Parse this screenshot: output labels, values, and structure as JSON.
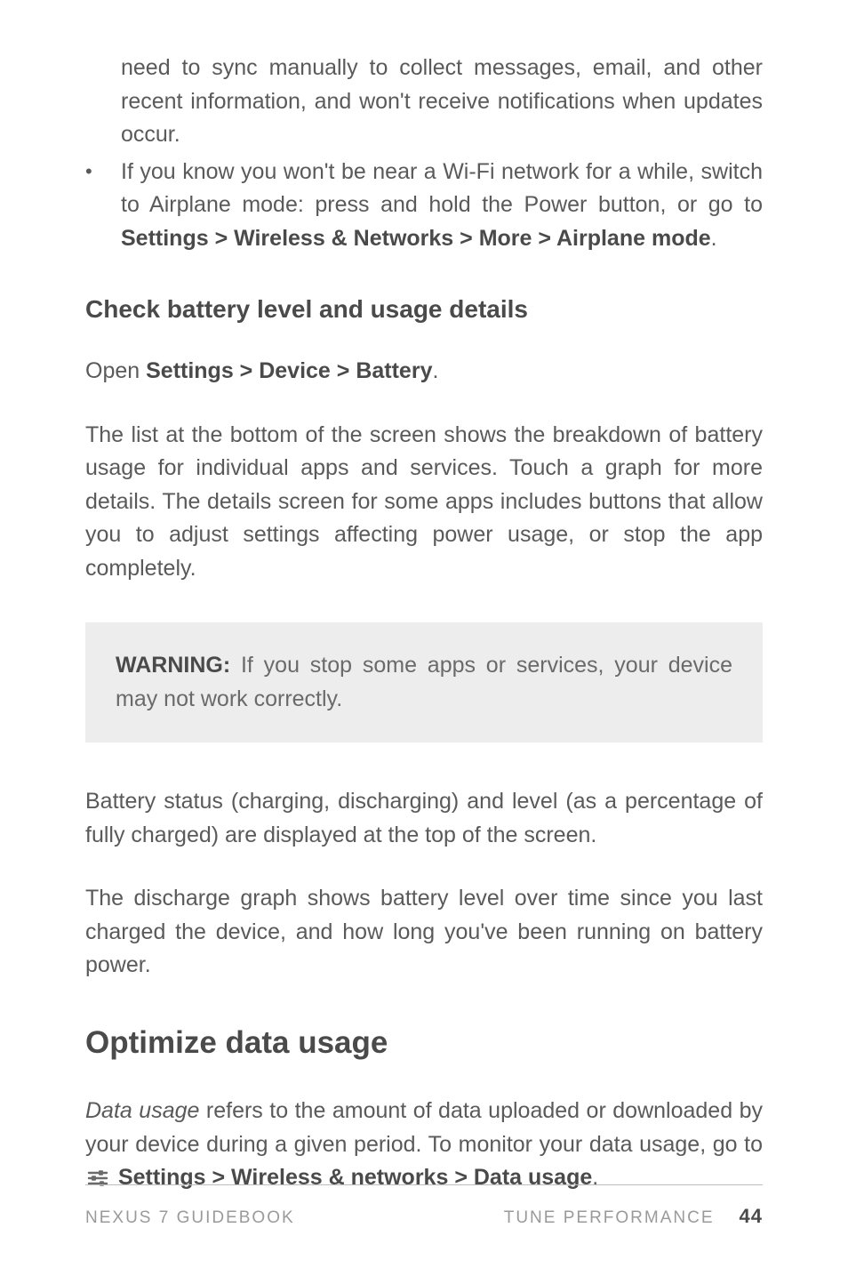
{
  "bullets": {
    "continuation": "need to sync manually to collect messages, email, and other recent information, and won't receive notifications when updates occur.",
    "item2_part1": "If you know you won't be near a Wi-Fi network for a while, switch to Airplane mode: press and hold the Power button, or go to ",
    "item2_bold": "Settings > Wireless & Networks > More > Airplane mode",
    "item2_part2": "."
  },
  "subhead": "Check battery level and usage details",
  "open_line_prefix": "Open ",
  "open_line_bold": "Settings > Device > Battery",
  "open_line_suffix": ".",
  "para1": "The list at the bottom of the screen shows the breakdown of battery usage for individual apps and services. Touch a graph for more details. The details screen for some apps includes buttons that allow you to adjust settings affecting power usage, or stop the app completely.",
  "callout_label": "WARNING:",
  "callout_body": " If you stop some apps or services, your device may not work correctly.",
  "para2": "Battery status (charging, discharging) and level (as a percentage of fully charged) are displayed at the top of the screen.",
  "para3": "The discharge graph shows battery level over time since you last charged the device, and how long you've been running on battery power.",
  "h2": "Optimize data usage",
  "data_usage_italic": "Data usage",
  "data_usage_rest": " refers to the amount of data uploaded or downloaded by your device during a given period. To monitor your data usage, go to ",
  "data_usage_bold": " Settings > Wireless & networks > Data usage",
  "data_usage_suffix": ".",
  "footer": {
    "left": "NEXUS 7 GUIDEBOOK",
    "right": "TUNE PERFORMANCE",
    "page": "44"
  }
}
